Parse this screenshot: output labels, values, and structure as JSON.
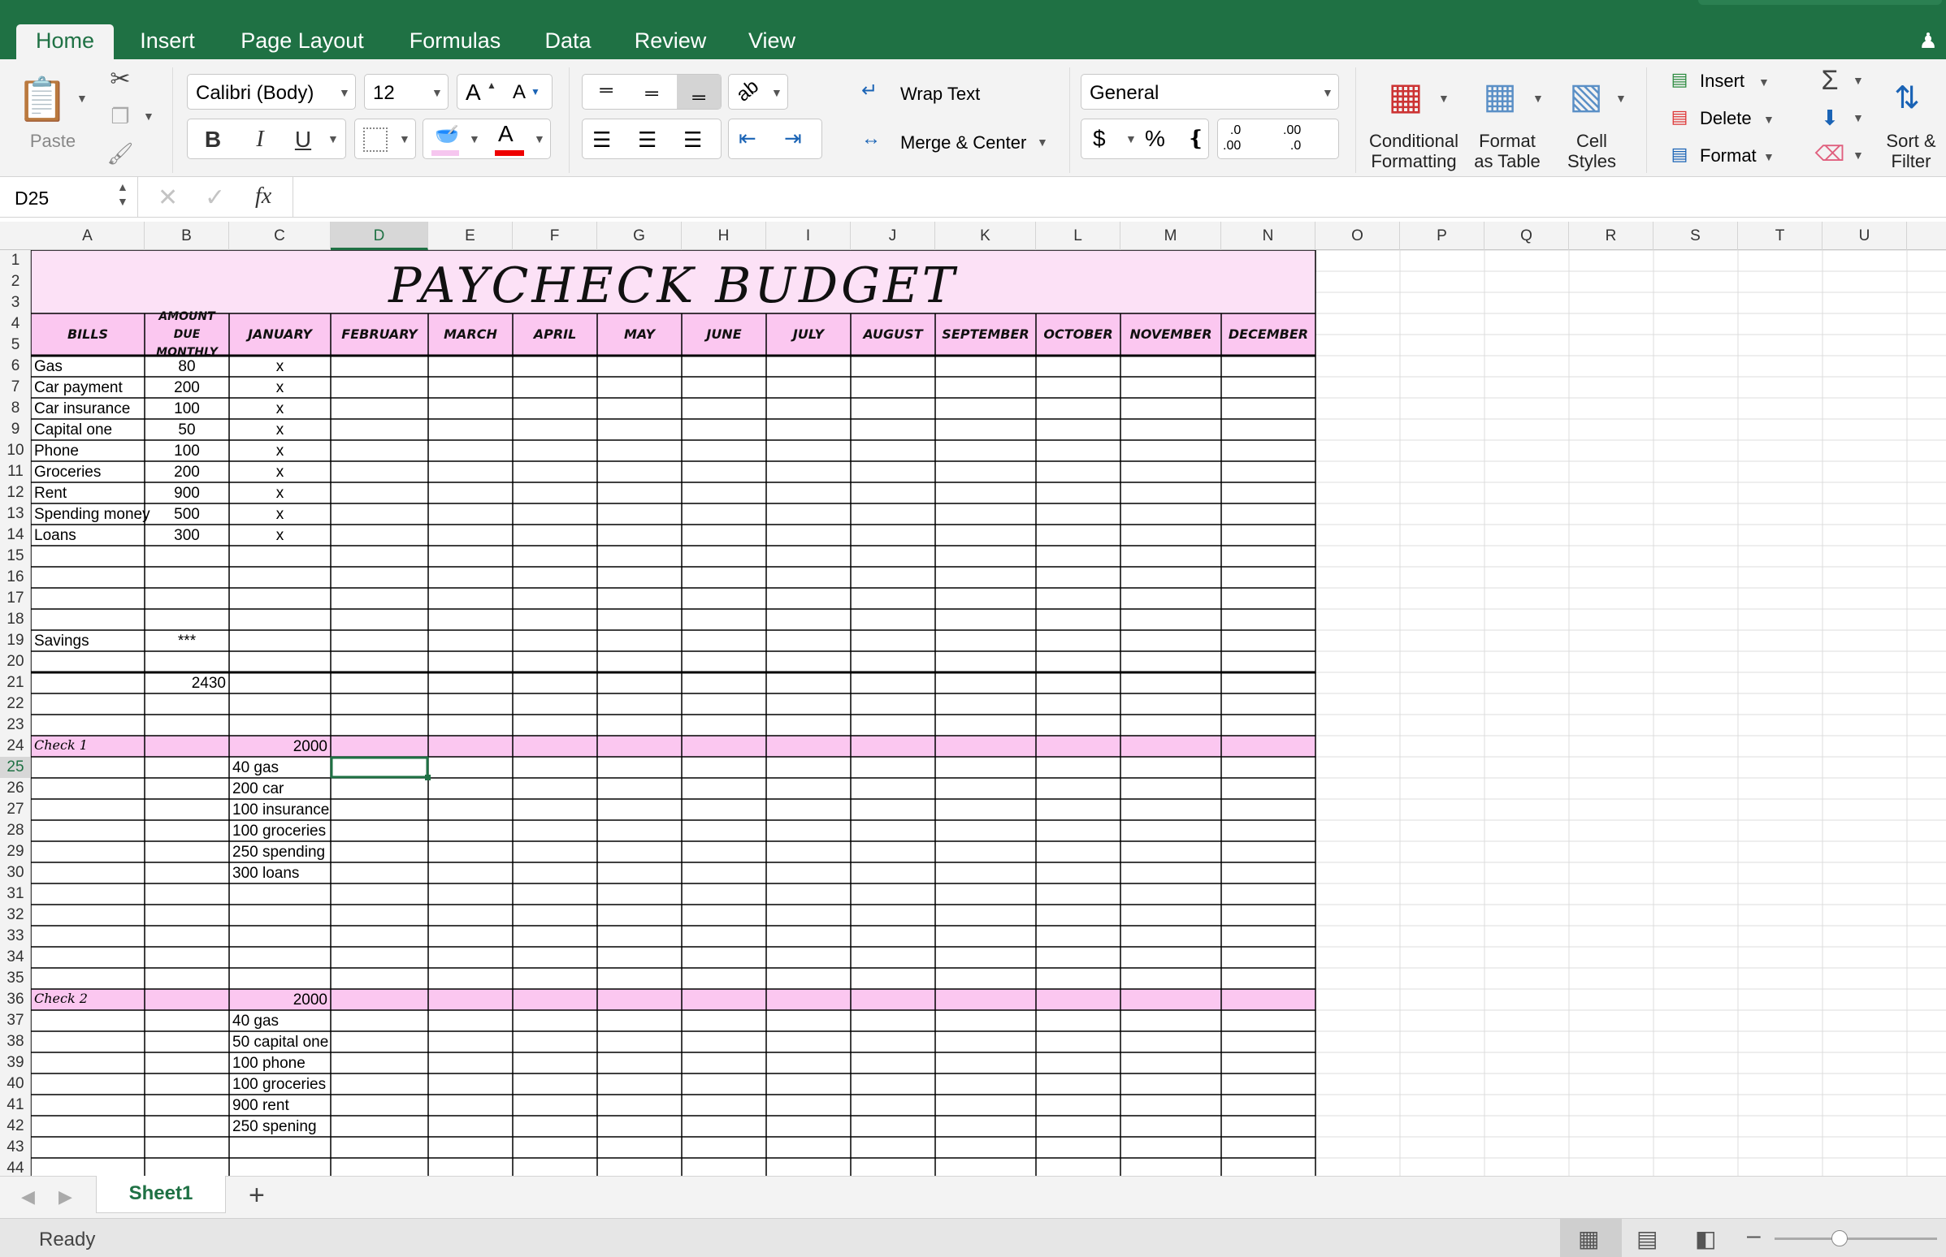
{
  "ribbon_tabs": [
    "Home",
    "Insert",
    "Page Layout",
    "Formulas",
    "Data",
    "Review",
    "View"
  ],
  "clipboard": {
    "paste": "Paste"
  },
  "font": {
    "name": "Calibri (Body)",
    "size": "12",
    "bold": "B",
    "italic": "I",
    "underline": "U",
    "grow": "A",
    "shrink": "A",
    "color_letter": "A"
  },
  "alignment": {
    "wrap": "Wrap Text",
    "merge": "Merge & Center"
  },
  "number": {
    "format": "General",
    "currency": "$",
    "percent": "%",
    "comma": "❴",
    "inc_dec": ".0\n.00",
    "dec_dec": ".00\n.0"
  },
  "styles": {
    "conditional": "Conditional\nFormatting",
    "format_table": "Format\nas Table",
    "cell_styles": "Cell\nStyles"
  },
  "cells_group": {
    "insert": "Insert",
    "delete": "Delete",
    "format": "Format"
  },
  "editing": {
    "sort": "Sort &\nFilter"
  },
  "formula_bar": {
    "name_box": "D25",
    "fx": "fx",
    "content": ""
  },
  "columns": [
    "A",
    "B",
    "C",
    "D",
    "E",
    "F",
    "G",
    "H",
    "I",
    "J",
    "K",
    "L",
    "M",
    "N",
    "O",
    "P",
    "Q",
    "R",
    "S",
    "T",
    "U"
  ],
  "rows": [
    "1",
    "2",
    "3",
    "4",
    "5",
    "6",
    "7",
    "8",
    "9",
    "10",
    "11",
    "12",
    "13",
    "14",
    "15",
    "16",
    "17",
    "18",
    "19",
    "20",
    "21",
    "22",
    "23",
    "24",
    "25",
    "26",
    "27",
    "28",
    "29",
    "30",
    "31",
    "32",
    "33",
    "34",
    "35",
    "36",
    "37",
    "38",
    "39",
    "40",
    "41",
    "42",
    "43",
    "44"
  ],
  "sheet": {
    "title": "PAYCHECK BUDGET",
    "headers": [
      "BILLS",
      "AMOUNT DUE MONTHLY",
      "JANUARY",
      "FEBRUARY",
      "MARCH",
      "APRIL",
      "MAY",
      "JUNE",
      "JULY",
      "AUGUST",
      "SEPTEMBER",
      "OCTOBER",
      "NOVEMBER",
      "DECEMBER"
    ],
    "bills": [
      {
        "name": "Gas",
        "amount": "80",
        "jan": "x"
      },
      {
        "name": "Car payment",
        "amount": "200",
        "jan": "x"
      },
      {
        "name": "Car insurance",
        "amount": "100",
        "jan": "x"
      },
      {
        "name": "Capital one",
        "amount": "50",
        "jan": "x"
      },
      {
        "name": "Phone",
        "amount": "100",
        "jan": "x"
      },
      {
        "name": "Groceries",
        "amount": "200",
        "jan": "x"
      },
      {
        "name": "Rent",
        "amount": "900",
        "jan": "x"
      },
      {
        "name": "Spending money",
        "amount": "500",
        "jan": "x"
      },
      {
        "name": "Loans",
        "amount": "300",
        "jan": "x"
      }
    ],
    "savings": {
      "name": "Savings",
      "amount": "***"
    },
    "total": "2430",
    "check1": {
      "label": "Check 1",
      "amount": "2000",
      "items": [
        "40 gas",
        "200 car",
        "100 insurance",
        "100 groceries",
        "250 spending",
        "300 loans"
      ]
    },
    "check2": {
      "label": "Check 2",
      "amount": "2000",
      "items": [
        "40 gas",
        "50 capital one",
        "100 phone",
        "100 groceries",
        "900 rent",
        "250 spening"
      ]
    }
  },
  "sheet_tabs": [
    "Sheet1"
  ],
  "add_sheet": "+",
  "status": "Ready",
  "colors": {
    "ribbon_green": "#1f7144",
    "header_pink": "#fbc7f0",
    "title_pink": "#fce1f6",
    "check_pink": "#fbc7f0",
    "selection": "#1f7144"
  }
}
